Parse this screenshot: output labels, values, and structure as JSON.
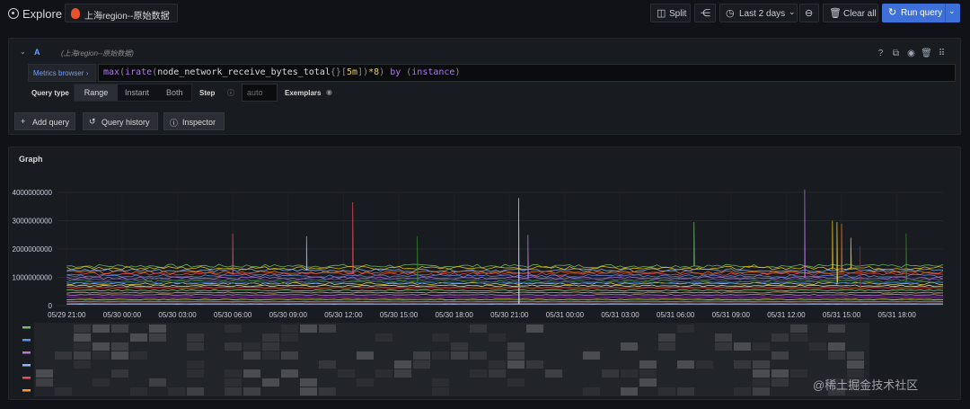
{
  "app": {
    "title": "Explore",
    "datasource": "上海region--原始数据"
  },
  "toolbar": {
    "split_label": "Split",
    "time_range": "Last 2 days",
    "clear_label": "Clear all",
    "run_label": "Run query"
  },
  "query": {
    "ref_id": "A",
    "datasource": "(上海region--原始数据)",
    "metrics_browser_label": "Metrics browser",
    "expression_tokens": [
      {
        "t": "max",
        "c": "fn"
      },
      {
        "t": "(",
        "c": "p"
      },
      {
        "t": "irate",
        "c": "fn"
      },
      {
        "t": "(",
        "c": "p"
      },
      {
        "t": "node_network_receive_bytes_total",
        "c": "mt"
      },
      {
        "t": "{",
        "c": "p"
      },
      {
        "t": "}",
        "c": "p"
      },
      {
        "t": "[",
        "c": "p"
      },
      {
        "t": "5m",
        "c": "n"
      },
      {
        "t": "]",
        "c": "p"
      },
      {
        "t": ")",
        "c": "p"
      },
      {
        "t": "*8",
        "c": "n"
      },
      {
        "t": ") ",
        "c": "p"
      },
      {
        "t": "by",
        "c": "fn"
      },
      {
        "t": " (",
        "c": "p"
      },
      {
        "t": "instance",
        "c": "d"
      },
      {
        "t": ")",
        "c": "p"
      }
    ],
    "query_type_label": "Query type",
    "query_types": [
      "Range",
      "Instant",
      "Both"
    ],
    "selected_query_type": "Range",
    "step_label": "Step",
    "step_placeholder": "auto",
    "exemplars_label": "Exemplars"
  },
  "actions": {
    "add_query": "Add query",
    "query_history": "Query history",
    "inspector": "Inspector"
  },
  "graph": {
    "title": "Graph"
  },
  "chart_data": {
    "type": "line",
    "title": "Graph",
    "y_ticks": [
      "0",
      "1000000000",
      "2000000000",
      "3000000000",
      "4000000000"
    ],
    "ylim": [
      0,
      4000000000
    ],
    "x_ticks": [
      "05/29 21:00",
      "05/30 00:00",
      "05/30 03:00",
      "05/30 06:00",
      "05/30 09:00",
      "05/30 12:00",
      "05/30 15:00",
      "05/30 18:00",
      "05/30 21:00",
      "05/31 00:00",
      "05/31 03:00",
      "05/31 06:00",
      "05/31 09:00",
      "05/31 12:00",
      "05/31 15:00",
      "05/31 18:00"
    ],
    "xlim": [
      "05/29 20:30",
      "05/31 20:30"
    ],
    "series": [
      {
        "color": "#73bf69",
        "base": 1400000000,
        "spikes": [
          [
            "05/31 07:00",
            2950000000
          ]
        ]
      },
      {
        "color": "#f2cc0c",
        "base": 1330000000,
        "spikes": [
          [
            "05/31 14:30",
            3000000000
          ],
          [
            "05/31 15:30",
            2400000000
          ]
        ]
      },
      {
        "color": "#8ab8ff",
        "base": 1250000000,
        "spikes": [
          [
            "05/30 10:00",
            2450000000
          ]
        ]
      },
      {
        "color": "#ff780a",
        "base": 1180000000,
        "spikes": [
          [
            "05/31 15:00",
            2900000000
          ]
        ]
      },
      {
        "color": "#f2495c",
        "base": 1120000000,
        "spikes": [
          [
            "05/30 06:00",
            2550000000
          ],
          [
            "05/30 12:30",
            3650000000
          ]
        ]
      },
      {
        "color": "#5794f2",
        "base": 1050000000,
        "spikes": []
      },
      {
        "color": "#b877d9",
        "base": 980000000,
        "spikes": [
          [
            "05/30 22:00",
            2500000000
          ],
          [
            "05/31 13:00",
            4100000000
          ]
        ]
      },
      {
        "color": "#705da0",
        "base": 920000000,
        "spikes": []
      },
      {
        "color": "#37872d",
        "base": 860000000,
        "spikes": [
          [
            "05/30 16:00",
            2450000000
          ],
          [
            "05/31 18:30",
            2550000000
          ]
        ]
      },
      {
        "color": "#fade2a",
        "base": 780000000,
        "spikes": [
          [
            "05/31 14:45",
            2950000000
          ]
        ]
      },
      {
        "color": "#e0f9d7",
        "base": 700000000,
        "spikes": []
      },
      {
        "color": "#c4162a",
        "base": 620000000,
        "spikes": [
          [
            "05/31 16:00",
            2100000000
          ]
        ]
      },
      {
        "color": "#96d98d",
        "base": 540000000,
        "spikes": []
      },
      {
        "color": "#ffb357",
        "base": 460000000,
        "spikes": []
      },
      {
        "color": "#ca95e5",
        "base": 380000000,
        "spikes": []
      },
      {
        "color": "#8f3bb8",
        "base": 300000000,
        "spikes": []
      },
      {
        "color": "#ffee52",
        "base": 220000000,
        "spikes": []
      },
      {
        "color": "#6ccf8e",
        "base": 150000000,
        "spikes": []
      },
      {
        "color": "#ff7383",
        "base": 90000000,
        "spikes": []
      },
      {
        "color": "#c0d8ff",
        "base": 50000000,
        "spikes": [
          [
            "05/30 21:30",
            3800000000
          ]
        ]
      },
      {
        "color": "#a16d2d",
        "base": 640000000,
        "spikes": []
      },
      {
        "color": "#3274d9",
        "base": 820000000,
        "spikes": []
      }
    ],
    "legend": {
      "colors": [
        "#73bf69",
        "#5794f2",
        "#b877d9",
        "#8ab8ff",
        "#f2495c",
        "#ff9830"
      ]
    }
  },
  "watermark": "@稀土掘金技术社区"
}
